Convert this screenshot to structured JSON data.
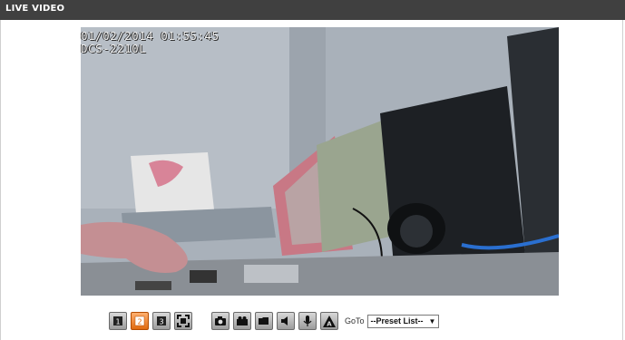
{
  "panel": {
    "title": "LIVE VIDEO"
  },
  "video": {
    "timestamp": "01/02/2014 01:55:45",
    "camera_name": "DCS-2210L"
  },
  "toolbar": {
    "buttons": [
      {
        "name": "stream-1-button",
        "icon": "digit-1",
        "label": "1",
        "active": false
      },
      {
        "name": "stream-2-button",
        "icon": "digit-2",
        "label": "2",
        "active": true
      },
      {
        "name": "stream-3-button",
        "icon": "digit-3",
        "label": "3",
        "active": false
      },
      {
        "name": "fullscreen-button",
        "icon": "fullscreen-icon",
        "active": false
      },
      {
        "name": "snapshot-button",
        "icon": "camera-icon",
        "active": false
      },
      {
        "name": "record-button",
        "icon": "record-icon",
        "active": false
      },
      {
        "name": "folder-button",
        "icon": "folder-icon",
        "active": false
      },
      {
        "name": "speaker-button",
        "icon": "speaker-icon",
        "active": false
      },
      {
        "name": "microphone-button",
        "icon": "microphone-icon",
        "active": false
      },
      {
        "name": "auto-pan-button",
        "icon": "a-icon",
        "label": "A",
        "active": false
      }
    ],
    "goto_label": "GoTo",
    "preset_select": {
      "selected": "--Preset List--"
    },
    "active_color": "#e06a10"
  }
}
